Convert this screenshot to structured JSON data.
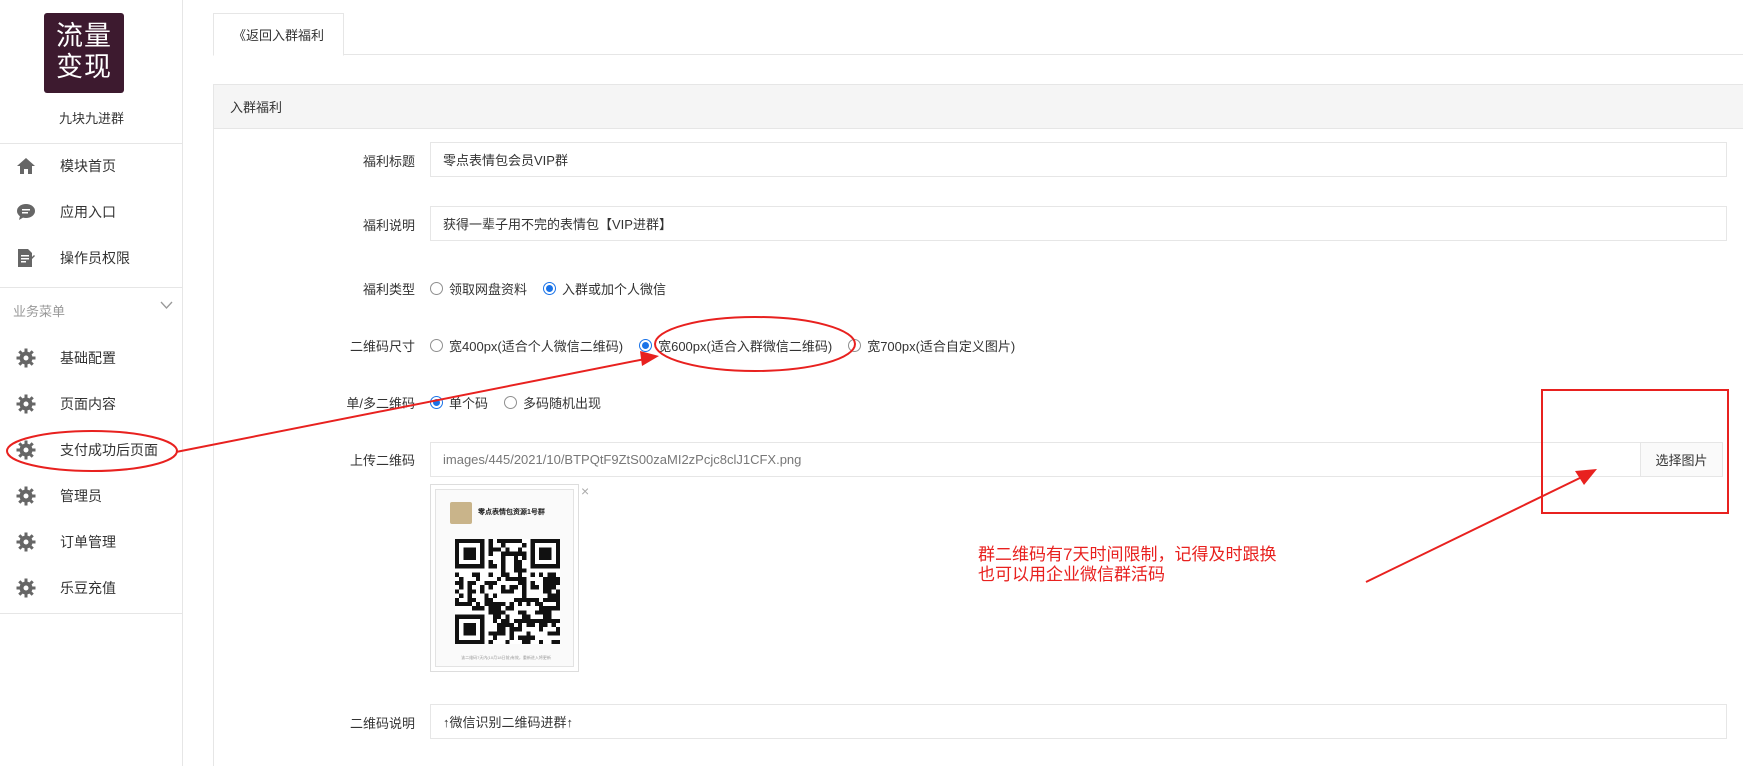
{
  "sidebar": {
    "logo_text_line1": "流量",
    "logo_text_line2": "变现",
    "brand": "九块九进群",
    "top_items": [
      {
        "label": "模块首页",
        "icon": "home-icon"
      },
      {
        "label": "应用入口",
        "icon": "chat-bubble-icon"
      },
      {
        "label": "操作员权限",
        "icon": "document-edit-icon"
      }
    ],
    "section_title": "业务菜单",
    "section_items": [
      {
        "label": "基础配置",
        "icon": "gear-icon"
      },
      {
        "label": "页面内容",
        "icon": "gear-icon"
      },
      {
        "label": "支付成功后页面",
        "icon": "gear-icon"
      },
      {
        "label": "管理员",
        "icon": "gear-icon"
      },
      {
        "label": "订单管理",
        "icon": "gear-icon"
      },
      {
        "label": "乐豆充值",
        "icon": "gear-icon"
      }
    ]
  },
  "tab": {
    "label": "《返回入群福利"
  },
  "panel": {
    "title": "入群福利"
  },
  "form": {
    "title_label": "福利标题",
    "title_value": "零点表情包会员VIP群",
    "desc_label": "福利说明",
    "desc_value": "获得一辈子用不完的表情包【VIP进群】",
    "type_label": "福利类型",
    "type_options": [
      "领取网盘资料",
      "入群或加个人微信"
    ],
    "type_selected_index": 1,
    "size_label": "二维码尺寸",
    "size_options": [
      "宽400px(适合个人微信二维码)",
      "宽600px(适合入群微信二维码)",
      "宽700px(适合自定义图片)"
    ],
    "size_selected_index": 1,
    "mode_label": "单/多二维码",
    "mode_options": [
      "单个码",
      "多码随机出现"
    ],
    "mode_selected_index": 0,
    "upload_label": "上传二维码",
    "upload_path": "images/445/2021/10/BTPQtF9ZtS00zaMI2zPcjc8clJ1CFX.png",
    "upload_button": "选择图片",
    "preview_title": "零点表情包资源1号群",
    "preview_caption": "该二维码7天内(10月18日前)有效，重新进入将更新",
    "remove_icon": "close-icon",
    "qr_desc_label": "二维码说明",
    "qr_desc_value": "↑微信识别二维码进群↑"
  },
  "annotation": {
    "line1": "群二维码有7天时间限制，记得及时跟换",
    "line2": "也可以用企业微信群活码",
    "color": "#e8211f"
  },
  "colors": {
    "accent": "#1a73e8",
    "logo_bg": "#3d1a2f"
  }
}
